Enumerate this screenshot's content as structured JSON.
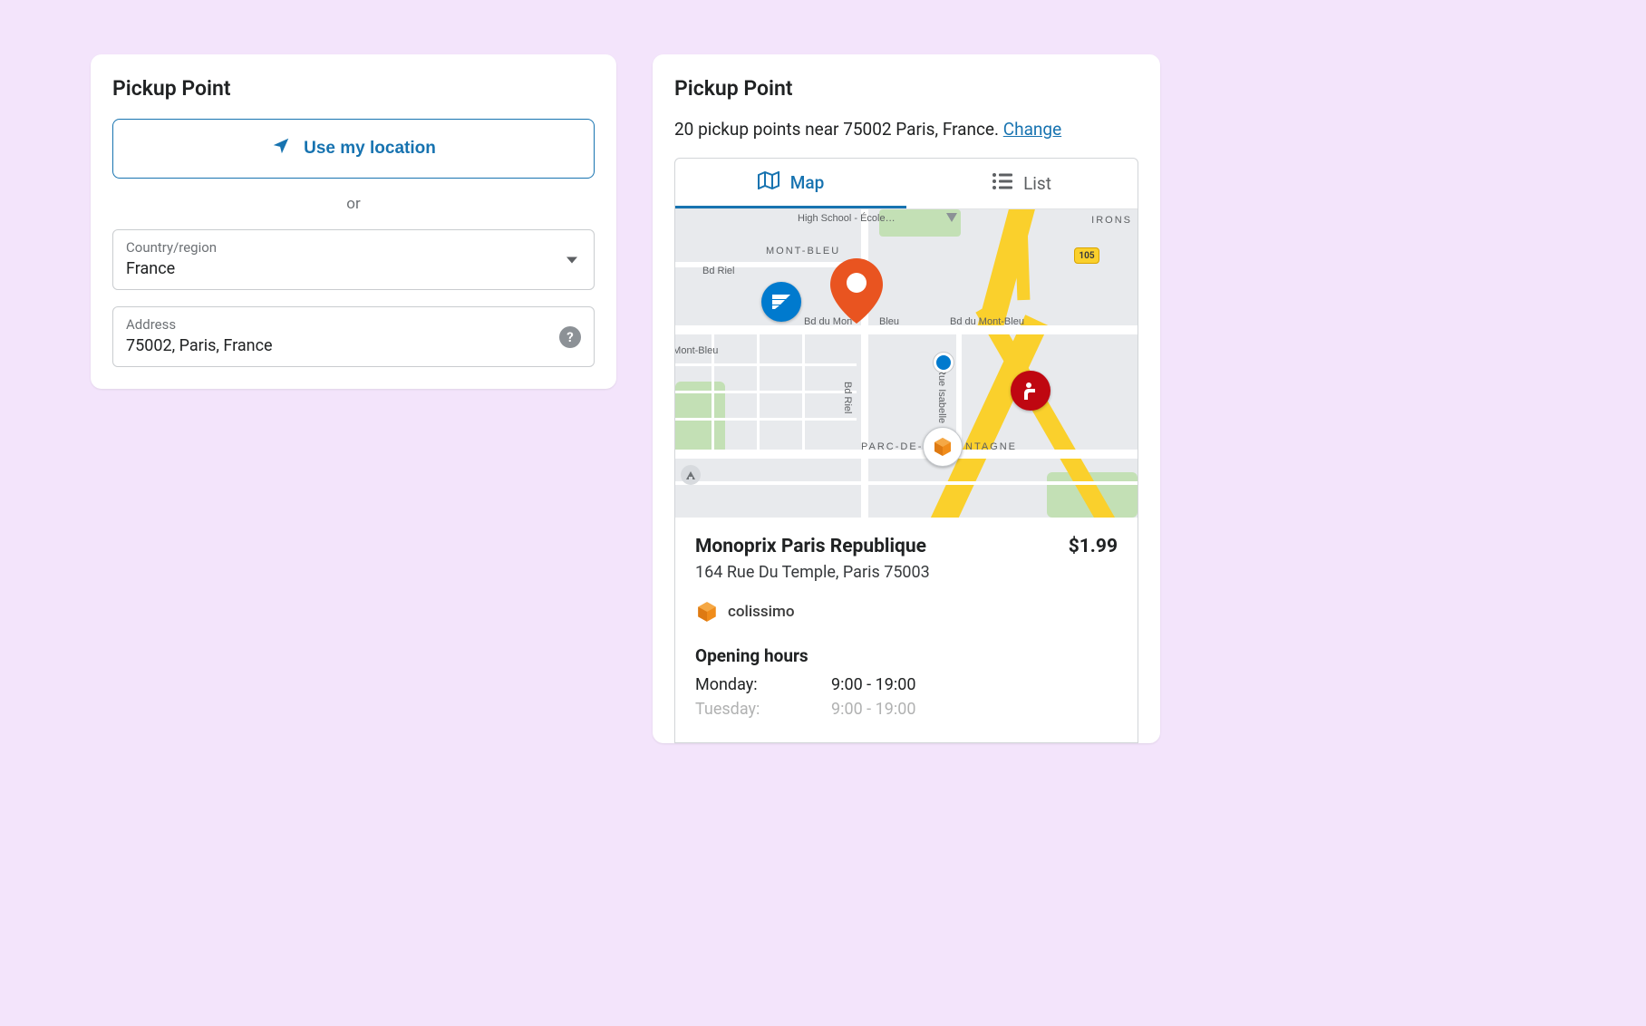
{
  "left_card": {
    "title": "Pickup Point",
    "use_location_label": "Use my location",
    "or_text": "or",
    "country_label": "Country/region",
    "country_value": "France",
    "address_label": "Address",
    "address_value": "75002, Paris, France"
  },
  "right_card": {
    "title": "Pickup Point",
    "summary_prefix": "20 pickup points near 75002 Paris, France. ",
    "change_label": "Change",
    "tabs": {
      "map": "Map",
      "list": "List"
    },
    "map_labels": {
      "highschool": "High School - École…",
      "montbleu": "MONT-BLEU",
      "bdriel_top": "Bd Riel",
      "bddumontbleu_left": "Bd du Mont-Bleu",
      "bddumontbleu_center": "Bd du Mon",
      "bleu_suffix": "Bleu",
      "bddumontbleu_right": "Bd du Mont-Bleu",
      "umontbleu": "u Mont-Bleu",
      "bdriel_vert": "Bd Riel",
      "rueisabelle": "Rue Isabelle",
      "parc": "PARC-DE-",
      "ntagne": "NTAGNE",
      "irons": "IRONS",
      "shield105": "105"
    },
    "detail": {
      "name": "Monoprix Paris Republique",
      "price": "$1.99",
      "address": "164 Rue Du Temple, Paris 75003",
      "carrier": "colissimo",
      "hours_title": "Opening hours",
      "hours": [
        {
          "day": "Monday:",
          "time": "9:00 - 19:00"
        },
        {
          "day": "Tuesday:",
          "time": "9:00 - 19:00"
        }
      ]
    }
  }
}
